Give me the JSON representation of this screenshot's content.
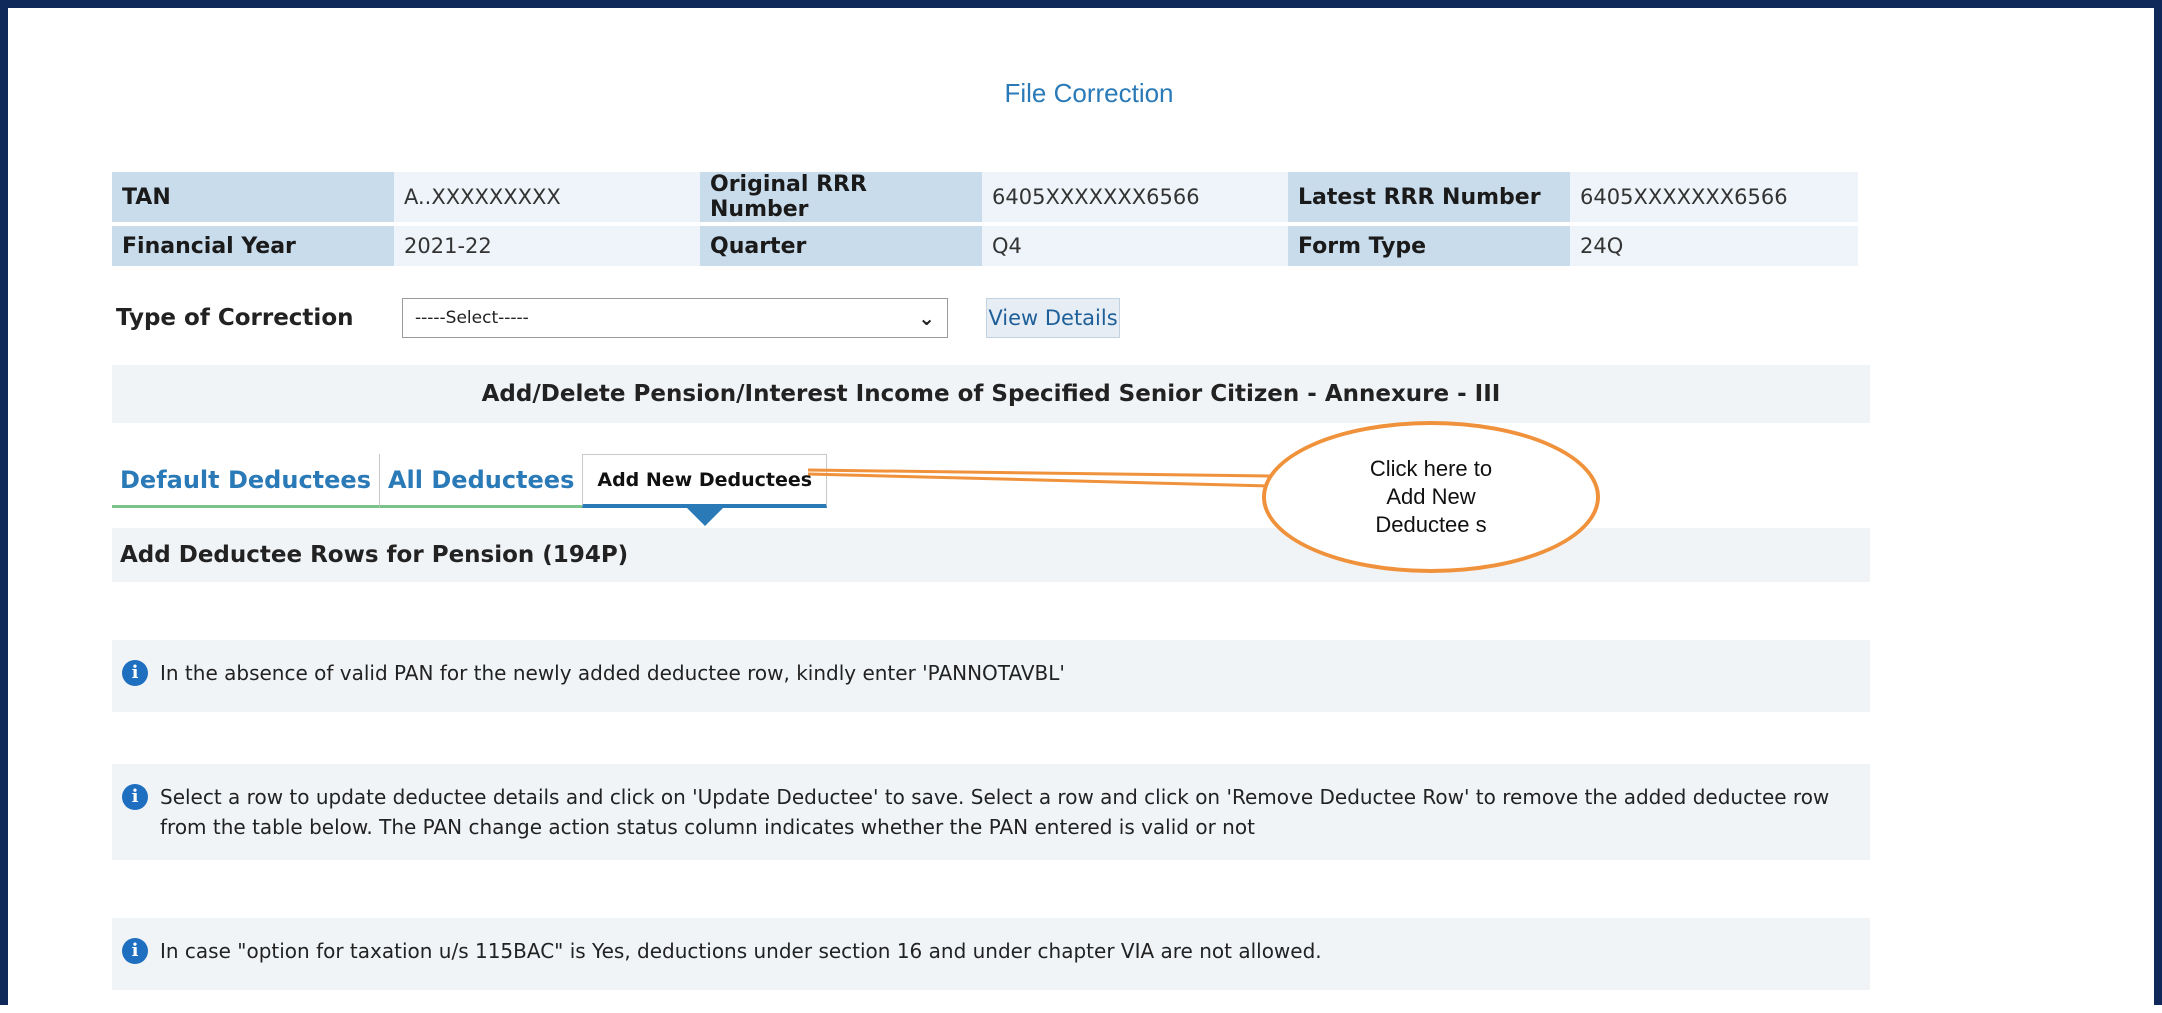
{
  "page": {
    "title": "File Correction"
  },
  "info": {
    "tan_label": "TAN",
    "tan_value": "A..XXXXXXXXX",
    "orig_rrr_label": "Original RRR Number",
    "orig_rrr_value": "6405XXXXXXX6566",
    "latest_rrr_label": "Latest RRR Number",
    "latest_rrr_value": "6405XXXXXXX6566",
    "fy_label": "Financial Year",
    "fy_value": "2021-22",
    "quarter_label": "Quarter",
    "quarter_value": "Q4",
    "form_type_label": "Form Type",
    "form_type_value": "24Q"
  },
  "correction": {
    "label": "Type of Correction",
    "select_value": "-----Select-----",
    "view_button": "View Details"
  },
  "section": {
    "heading": "Add/Delete Pension/Interest Income of Specified Senior Citizen - Annexure - III"
  },
  "tabs": [
    {
      "label": "Default Deductees"
    },
    {
      "label": "All Deductees"
    },
    {
      "label": "Add New Deductees"
    }
  ],
  "subheading": "Add Deductee Rows for Pension (194P)",
  "notes": [
    "In the absence of valid PAN for the newly added deductee row, kindly enter 'PANNOTAVBL'",
    "Select a row to update deductee details and click on 'Update Deductee' to save. Select a row and click on 'Remove Deductee Row' to remove the added deductee row from the table below. The PAN change action status column indicates whether the PAN entered is valid or not",
    "In case \"option for taxation u/s 115BAC\" is Yes, deductions under section 16 and under chapter VIA are not allowed."
  ],
  "callout": {
    "text": "Click here to Add New Deductee s"
  },
  "colors": {
    "accent": "#2a7ab8",
    "label_bg": "#c9dcec",
    "callout": "#f0923c",
    "frame": "#0f2a5a"
  }
}
